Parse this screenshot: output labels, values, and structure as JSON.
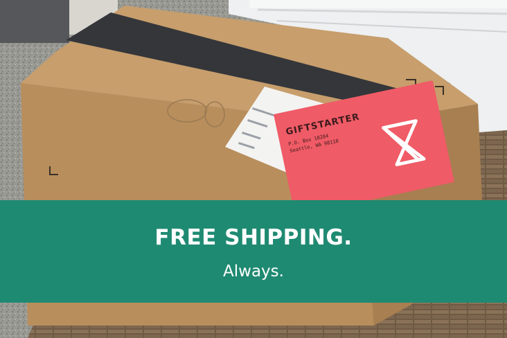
{
  "banner": {
    "headline": "FREE SHIPPING.",
    "subline": "Always.",
    "background_color": "#1f8a72"
  },
  "envelope": {
    "brand": "GIFTSTARTER",
    "address_line1": "P.O. Box 18284",
    "address_line2": "Seattle, WA 98118",
    "color": "#ef5b66"
  },
  "photo": {
    "subjects": [
      "cardboard-box",
      "envelope",
      "shipping-label",
      "door",
      "doormat"
    ]
  }
}
